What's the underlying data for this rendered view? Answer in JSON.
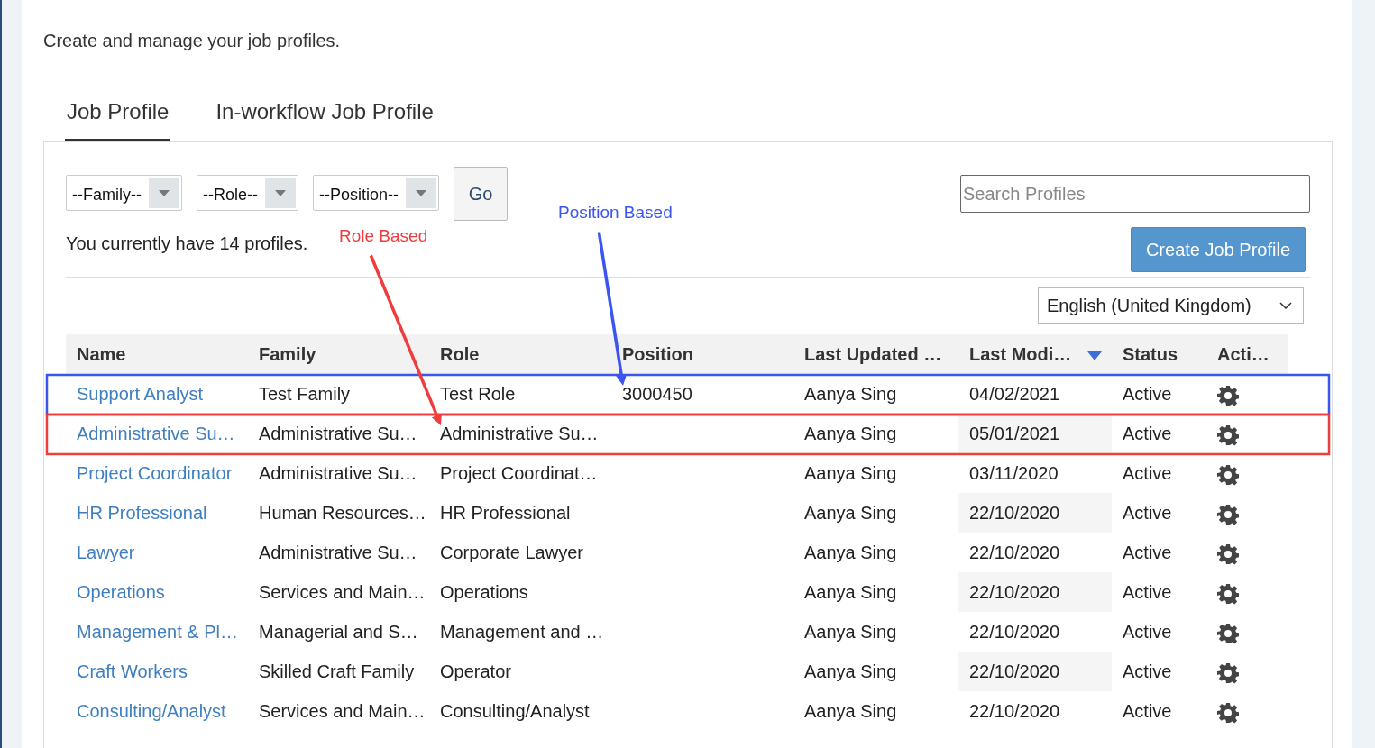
{
  "intro": "Create and manage your job profiles.",
  "tabs": [
    {
      "label": "Job Profile",
      "selected": true
    },
    {
      "label": "In-workflow Job Profile",
      "selected": false
    }
  ],
  "filters": [
    {
      "label": "--Family--"
    },
    {
      "label": "--Role--"
    },
    {
      "label": "--Position--"
    }
  ],
  "go_button": "Go",
  "search": {
    "placeholder": "Search Profiles"
  },
  "profile_count": "You currently have 14 profiles.",
  "create_button": "Create Job Profile",
  "language": "English (United Kingdom)",
  "table": {
    "columns": [
      {
        "label": "Name",
        "kind": "name",
        "sorted": false
      },
      {
        "label": "Family",
        "kind": "family",
        "sorted": false
      },
      {
        "label": "Role",
        "kind": "role",
        "sorted": false
      },
      {
        "label": "Position",
        "kind": "position",
        "sorted": false
      },
      {
        "label": "Last Updated …",
        "kind": "updated_by",
        "sorted": false
      },
      {
        "label": "Last Modi…",
        "kind": "modified",
        "sorted": true
      },
      {
        "label": "Status",
        "kind": "status",
        "sorted": false
      },
      {
        "label": "Acti…",
        "kind": "actions",
        "sorted": false
      }
    ],
    "rows": [
      {
        "cells": [
          "Support Analyst",
          "Test Family",
          "Test Role",
          "3000450",
          "Aanya Sing",
          "04/02/2021",
          "Active"
        ],
        "annotation": {
          "label": "Position Based",
          "color": "#3b55f0",
          "kind": "position"
        }
      },
      {
        "cells": [
          "Administrative Su…",
          "Administrative Su…",
          "Administrative Su…",
          "",
          "Aanya Sing",
          "05/01/2021",
          "Active"
        ],
        "annotation": {
          "label": "Role Based",
          "color": "#f03c3c",
          "kind": "role"
        }
      },
      {
        "cells": [
          "Project Coordinator",
          "Administrative Su…",
          "Project Coordinat…",
          "",
          "Aanya Sing",
          "03/11/2020",
          "Active"
        ]
      },
      {
        "cells": [
          "HR Professional",
          "Human Resources…",
          "HR Professional",
          "",
          "Aanya Sing",
          "22/10/2020",
          "Active"
        ]
      },
      {
        "cells": [
          "Lawyer",
          "Administrative Su…",
          "Corporate Lawyer",
          "",
          "Aanya Sing",
          "22/10/2020",
          "Active"
        ]
      },
      {
        "cells": [
          "Operations",
          "Services and Main…",
          "Operations",
          "",
          "Aanya Sing",
          "22/10/2020",
          "Active"
        ]
      },
      {
        "cells": [
          "Management & Pl…",
          "Managerial and S…",
          "Management and …",
          "",
          "Aanya Sing",
          "22/10/2020",
          "Active"
        ]
      },
      {
        "cells": [
          "Craft Workers",
          "Skilled Craft Family",
          "Operator",
          "",
          "Aanya Sing",
          "22/10/2020",
          "Active"
        ]
      },
      {
        "cells": [
          "Consulting/Analyst",
          "Services and Main…",
          "Consulting/Analyst",
          "",
          "Aanya Sing",
          "22/10/2020",
          "Active"
        ]
      }
    ]
  }
}
